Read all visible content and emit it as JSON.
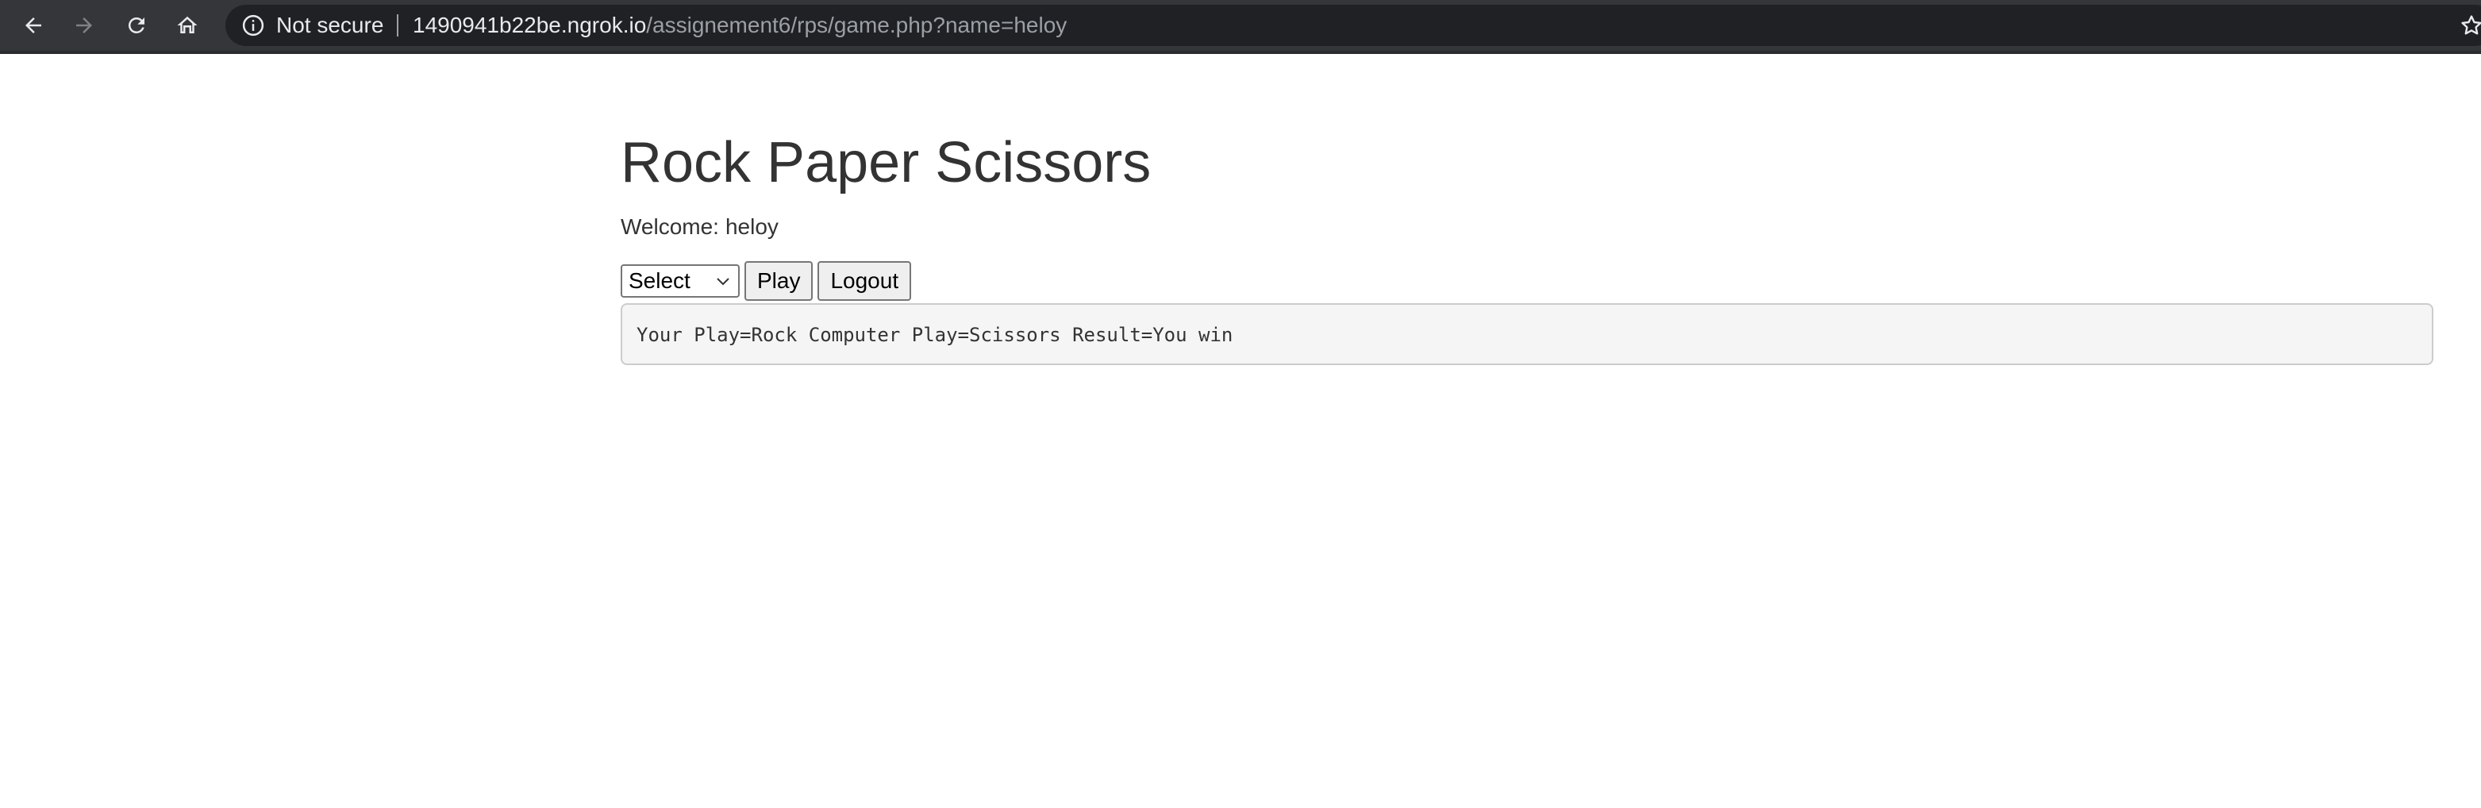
{
  "browser": {
    "security_label": "Not secure",
    "url_host": "1490941b22be.ngrok.io",
    "url_path": "/assignement6/rps/game.php?name=heloy",
    "icons": [
      "back-arrow-icon",
      "forward-arrow-icon",
      "reload-icon",
      "home-icon",
      "info-icon",
      "star-icon"
    ]
  },
  "page": {
    "title": "Rock Paper Scissors",
    "welcome_label": "Welcome:",
    "user_name": "heloy",
    "select_value": "Select",
    "play_label": "Play",
    "logout_label": "Logout",
    "result_text": "Your Play=Rock Computer Play=Scissors Result=You win"
  }
}
